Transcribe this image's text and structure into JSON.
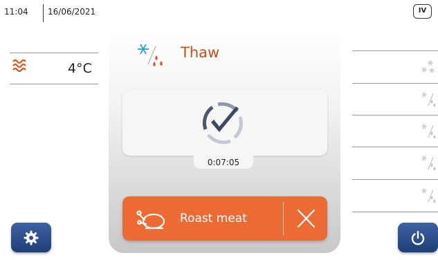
{
  "header": {
    "time": "11:04",
    "date": "16/06/2021",
    "level_badge": "IV"
  },
  "left_panel": {
    "icon": "heat-waves-icon",
    "temperature": "4°C"
  },
  "center": {
    "mode_icon": "thaw-snowflake-drops-icon",
    "mode_label": "Thaw",
    "status_icon": "check-progress-icon",
    "timer": "0:07:05",
    "program": {
      "icon": "roast-chicken-icon",
      "label": "Roast meat",
      "cancel_icon": "close-icon"
    }
  },
  "right_list": {
    "items": [
      {
        "icon": "deep-freeze-snowflakes-icon"
      },
      {
        "icon": "thaw-icon"
      },
      {
        "icon": "thaw-icon"
      },
      {
        "icon": "thaw-icon"
      },
      {
        "icon": "thaw-icon"
      }
    ]
  },
  "bottom": {
    "settings_icon": "gear-icon",
    "power_icon": "power-icon"
  },
  "colors": {
    "accent_orange": "#ec6b35",
    "mode_text": "#c0521e",
    "button_blue": "#2d4f8e",
    "snow_blue": "#2aa3d6"
  }
}
